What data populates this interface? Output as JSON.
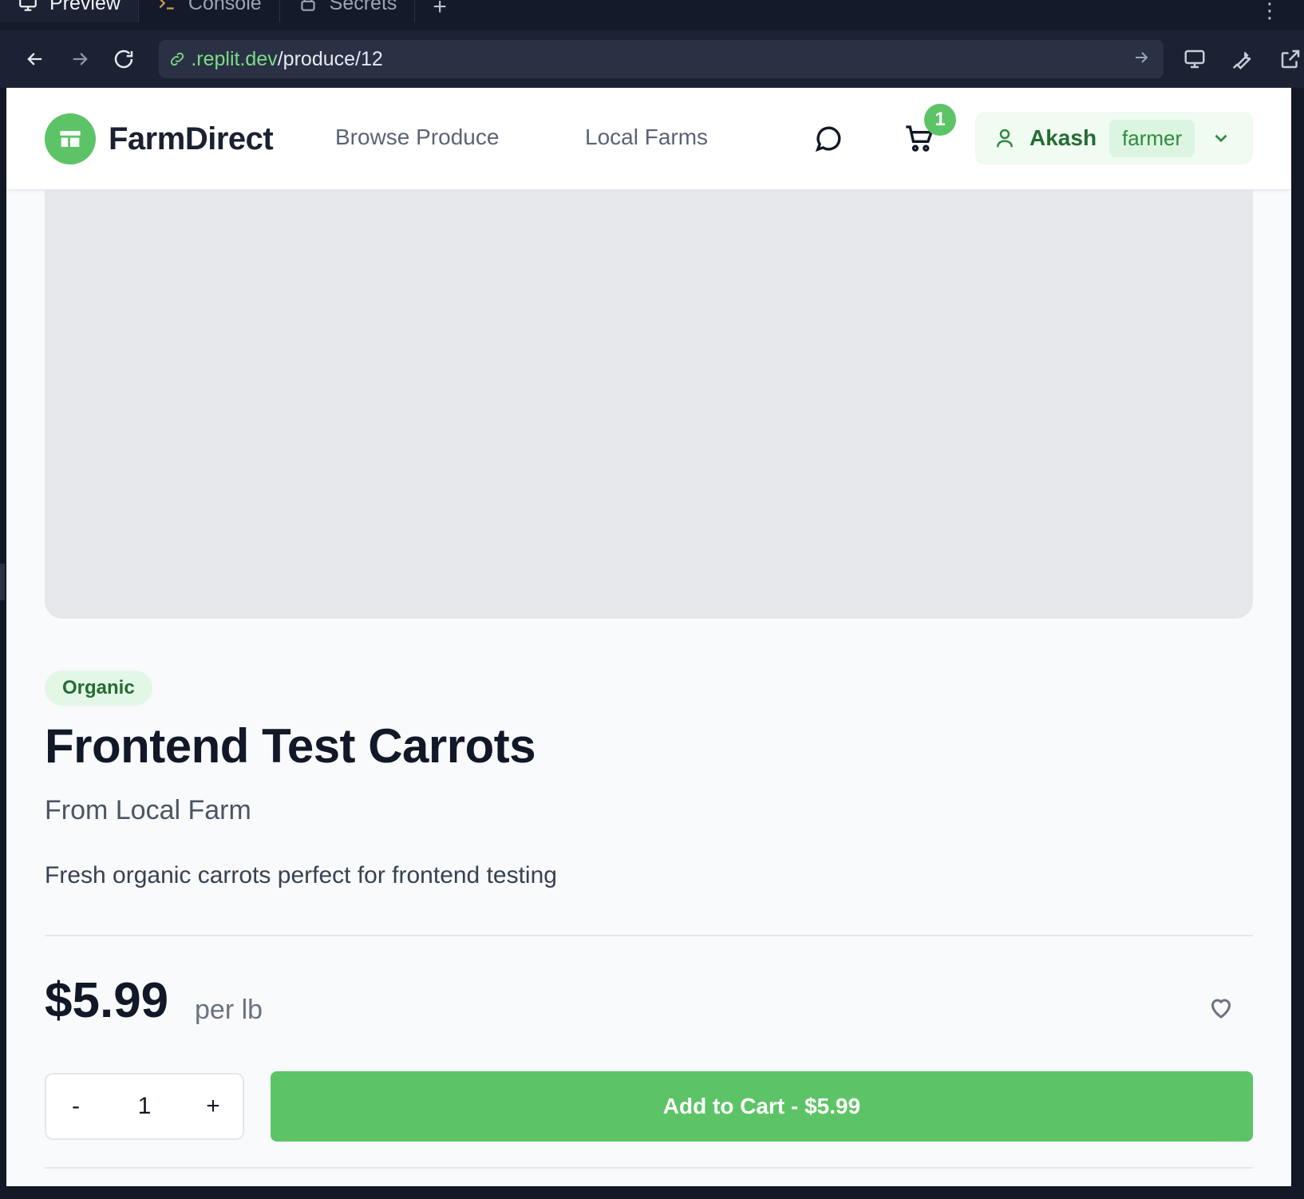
{
  "tabs": [
    {
      "label": "Preview",
      "icon": "monitor-icon",
      "active": true
    },
    {
      "label": "Console",
      "icon": "terminal-icon",
      "active": false
    },
    {
      "label": "Secrets",
      "icon": "lock-icon",
      "active": false
    }
  ],
  "url": {
    "host": ".replit.dev",
    "path": "/produce/12"
  },
  "site": {
    "brand": "FarmDirect",
    "nav": [
      "Browse Produce",
      "Local Farms"
    ],
    "cart_count": "1",
    "user": {
      "name": "Akash",
      "role": "farmer"
    }
  },
  "product": {
    "badge": "Organic",
    "title": "Frontend Test Carrots",
    "farm": "From Local Farm",
    "description": "Fresh organic carrots perfect for frontend testing",
    "price": "$5.99",
    "unit": "per lb",
    "quantity": "1",
    "decrement": "-",
    "increment": "+",
    "add_to_cart": "Add to Cart - $5.99"
  },
  "colors": {
    "accent": "#5cc466",
    "ide_bg": "#141a29"
  }
}
